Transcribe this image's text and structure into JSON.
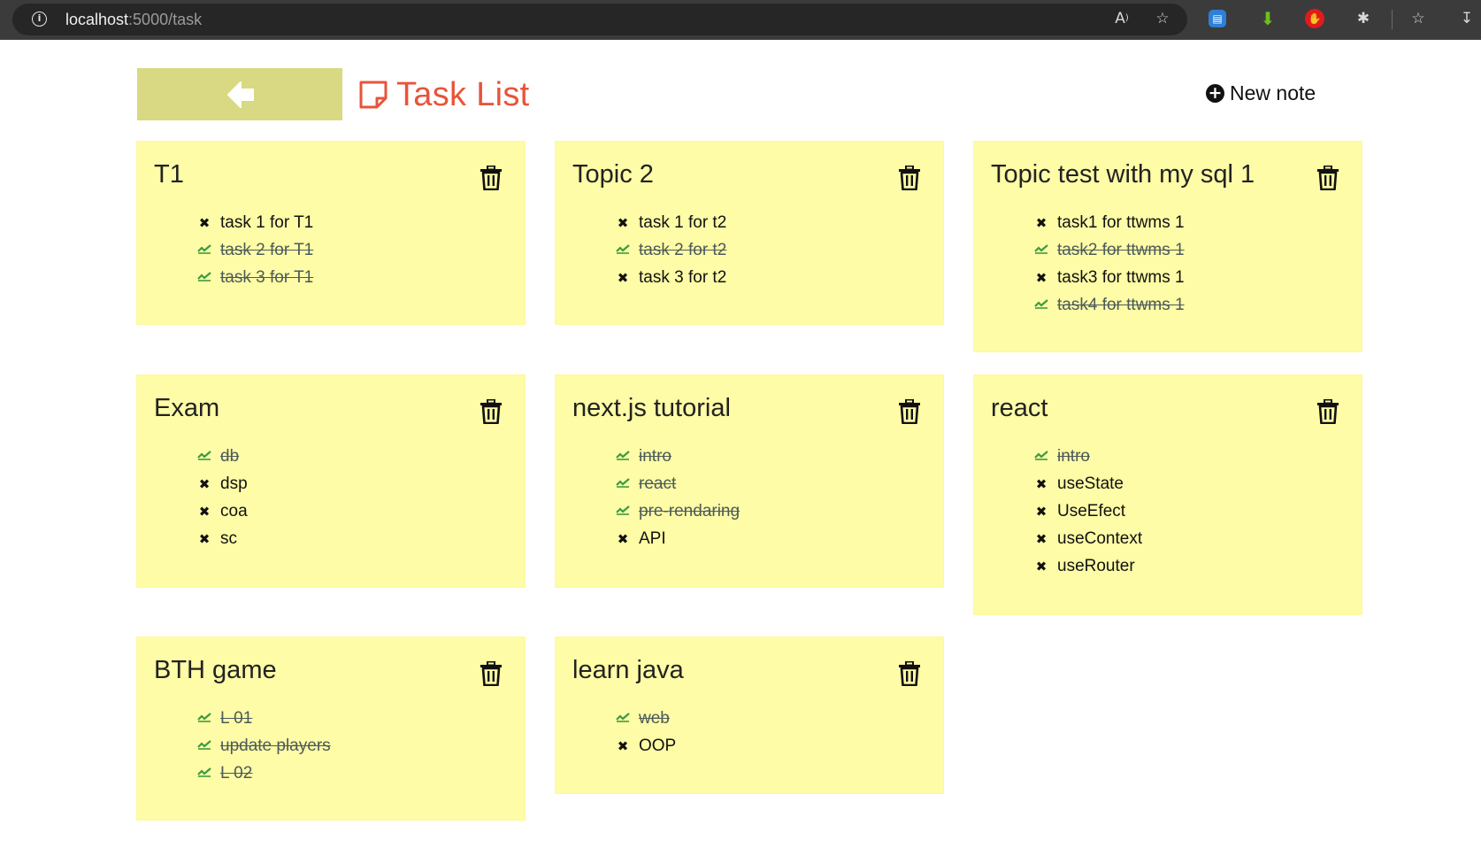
{
  "browser": {
    "url_host": "localhost",
    "url_path": ":5000/task",
    "info_icon": "info-icon"
  },
  "header": {
    "back_icon": "arrow-left-icon",
    "title": "Task List",
    "title_icon": "sticky-note-icon",
    "new_note_label": "New note",
    "new_note_icon": "plus-circle-icon"
  },
  "colors": {
    "note_background": "#fefca6",
    "back_button": "#d8d982",
    "title": "#e8543a",
    "done_check": "#3f9a3f"
  },
  "notes": [
    {
      "title": "T1",
      "tasks": [
        {
          "text": "task 1 for T1",
          "done": false
        },
        {
          "text": "task 2 for T1",
          "done": true
        },
        {
          "text": "task 3 for T1",
          "done": true
        }
      ]
    },
    {
      "title": "Topic 2",
      "tasks": [
        {
          "text": "task 1 for t2",
          "done": false
        },
        {
          "text": "task 2 for t2",
          "done": true
        },
        {
          "text": "task 3 for t2",
          "done": false
        }
      ]
    },
    {
      "title": "Topic test with my sql 1",
      "tasks": [
        {
          "text": "task1 for ttwms 1",
          "done": false
        },
        {
          "text": "task2 for ttwms 1",
          "done": true
        },
        {
          "text": "task3 for ttwms 1",
          "done": false
        },
        {
          "text": "task4 for ttwms 1",
          "done": true
        }
      ]
    },
    {
      "title": "Exam",
      "tasks": [
        {
          "text": "db",
          "done": true
        },
        {
          "text": "dsp",
          "done": false
        },
        {
          "text": "coa",
          "done": false
        },
        {
          "text": "sc",
          "done": false
        }
      ]
    },
    {
      "title": "next.js tutorial",
      "tasks": [
        {
          "text": "intro",
          "done": true
        },
        {
          "text": "react",
          "done": true
        },
        {
          "text": "pre-rendaring",
          "done": true
        },
        {
          "text": "API",
          "done": false
        }
      ]
    },
    {
      "title": "react",
      "tasks": [
        {
          "text": "intro",
          "done": true
        },
        {
          "text": "useState",
          "done": false
        },
        {
          "text": "UseEfect",
          "done": false
        },
        {
          "text": "useContext",
          "done": false
        },
        {
          "text": "useRouter",
          "done": false
        }
      ]
    },
    {
      "title": "BTH game",
      "tasks": [
        {
          "text": "L 01",
          "done": true
        },
        {
          "text": "update players",
          "done": true
        },
        {
          "text": "L 02",
          "done": true
        }
      ]
    },
    {
      "title": "learn java",
      "tasks": [
        {
          "text": "web",
          "done": true
        },
        {
          "text": "OOP",
          "done": false
        }
      ]
    }
  ]
}
